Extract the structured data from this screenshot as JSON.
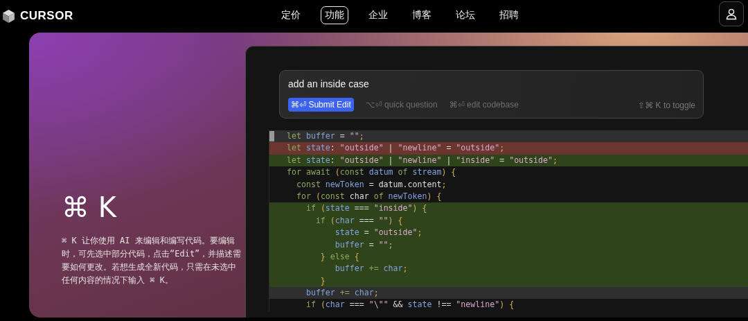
{
  "nav": {
    "logo": "CURSOR",
    "items": [
      {
        "label": "定价",
        "selected": false
      },
      {
        "label": "功能",
        "selected": true
      },
      {
        "label": "企业",
        "selected": false
      },
      {
        "label": "博客",
        "selected": false
      },
      {
        "label": "论坛",
        "selected": false
      },
      {
        "label": "招聘",
        "selected": false
      }
    ]
  },
  "hero": {
    "title": "⌘ K",
    "description": "⌘ K 让你使用 AI 来编辑和编写代码。要编辑时，可先选中部分代码，点击“Edit”，并描述需要如何更改。若想生成全新代码，只需在未选中任何内容的情况下输入 ⌘ K。"
  },
  "editor": {
    "prompt": {
      "value": "add an inside case",
      "actions": [
        {
          "label": "⌘⏎ Submit Edit",
          "kind": "primary"
        },
        {
          "label": "⌥⏎ quick question",
          "kind": "hint"
        },
        {
          "label": "⌘⏎ edit codebase",
          "kind": "hint"
        }
      ],
      "toggle_hint": "⇧⌘ K to toggle"
    },
    "lines": [
      {
        "kind": "current",
        "tokens": [
          {
            "kind": "kw",
            "text": "let "
          },
          {
            "kind": "var",
            "text": "buffer"
          },
          {
            "kind": "op",
            "text": " = "
          },
          {
            "kind": "str",
            "text": "\"\""
          },
          {
            "kind": "pun",
            "text": ";"
          }
        ]
      },
      {
        "kind": "removed",
        "tokens": [
          {
            "kind": "kw",
            "text": "let "
          },
          {
            "kind": "var",
            "text": "state"
          },
          {
            "kind": "op",
            "text": ": "
          },
          {
            "kind": "str",
            "text": "\"outside\""
          },
          {
            "kind": "op",
            "text": " | "
          },
          {
            "kind": "str",
            "text": "\"newline\""
          },
          {
            "kind": "op",
            "text": " = "
          },
          {
            "kind": "str",
            "text": "\"outside\""
          },
          {
            "kind": "pun",
            "text": ";"
          }
        ]
      },
      {
        "kind": "added",
        "tokens": [
          {
            "kind": "kw",
            "text": "let "
          },
          {
            "kind": "var",
            "text": "state"
          },
          {
            "kind": "op",
            "text": ": "
          },
          {
            "kind": "str",
            "text": "\"outside\""
          },
          {
            "kind": "op",
            "text": " | "
          },
          {
            "kind": "str",
            "text": "\"newline\""
          },
          {
            "kind": "op",
            "text": " | "
          },
          {
            "kind": "str",
            "text": "\"inside\""
          },
          {
            "kind": "op",
            "text": " = "
          },
          {
            "kind": "str",
            "text": "\"outside\""
          },
          {
            "kind": "pun",
            "text": ";"
          }
        ]
      },
      {
        "kind": "normal",
        "tokens": [
          {
            "kind": "kw",
            "text": "for await "
          },
          {
            "kind": "pun",
            "text": "("
          },
          {
            "kind": "kw",
            "text": "const "
          },
          {
            "kind": "var",
            "text": "datum"
          },
          {
            "kind": "kw",
            "text": " of "
          },
          {
            "kind": "var",
            "text": "stream"
          },
          {
            "kind": "pun",
            "text": ") {"
          }
        ]
      },
      {
        "kind": "normal",
        "tokens": [
          {
            "kind": "kw",
            "text": "  const "
          },
          {
            "kind": "var",
            "text": "newToken"
          },
          {
            "kind": "op",
            "text": " = datum.content"
          },
          {
            "kind": "pun",
            "text": ";"
          }
        ]
      },
      {
        "kind": "normal",
        "tokens": [
          {
            "kind": "kw",
            "text": "  for "
          },
          {
            "kind": "pun",
            "text": "("
          },
          {
            "kind": "kw",
            "text": "const "
          },
          {
            "kind": "op",
            "text": "char"
          },
          {
            "kind": "kw",
            "text": " of "
          },
          {
            "kind": "var",
            "text": "newToken"
          },
          {
            "kind": "pun",
            "text": ") {"
          }
        ]
      },
      {
        "kind": "added",
        "tokens": [
          {
            "kind": "kw",
            "text": "    if "
          },
          {
            "kind": "pun",
            "text": "("
          },
          {
            "kind": "var",
            "text": "state"
          },
          {
            "kind": "op",
            "text": " === "
          },
          {
            "kind": "str",
            "text": "\"inside\""
          },
          {
            "kind": "pun",
            "text": ") {"
          }
        ]
      },
      {
        "kind": "added",
        "tokens": [
          {
            "kind": "kw",
            "text": "      if "
          },
          {
            "kind": "pun",
            "text": "("
          },
          {
            "kind": "var",
            "text": "char"
          },
          {
            "kind": "op",
            "text": " === "
          },
          {
            "kind": "str",
            "text": "\"\""
          },
          {
            "kind": "pun",
            "text": ") {"
          }
        ]
      },
      {
        "kind": "added",
        "tokens": [
          {
            "kind": "var",
            "text": "          state"
          },
          {
            "kind": "op",
            "text": " = "
          },
          {
            "kind": "str",
            "text": "\"outside\""
          },
          {
            "kind": "pun",
            "text": ";"
          }
        ]
      },
      {
        "kind": "added",
        "tokens": [
          {
            "kind": "var",
            "text": "          buffer"
          },
          {
            "kind": "op",
            "text": " = "
          },
          {
            "kind": "str",
            "text": "\"\""
          },
          {
            "kind": "pun",
            "text": ";"
          }
        ]
      },
      {
        "kind": "added",
        "tokens": [
          {
            "kind": "pun",
            "text": "       } "
          },
          {
            "kind": "kw",
            "text": "else "
          },
          {
            "kind": "pun",
            "text": "{"
          }
        ]
      },
      {
        "kind": "added",
        "tokens": [
          {
            "kind": "var",
            "text": "          buffer"
          },
          {
            "kind": "kw",
            "text": " += "
          },
          {
            "kind": "var",
            "text": "char"
          },
          {
            "kind": "pun",
            "text": ";"
          }
        ]
      },
      {
        "kind": "added",
        "tokens": [
          {
            "kind": "pun",
            "text": "       }"
          }
        ]
      },
      {
        "kind": "current",
        "tokens": [
          {
            "kind": "var",
            "text": "    buffer"
          },
          {
            "kind": "kw",
            "text": " += "
          },
          {
            "kind": "var",
            "text": "char"
          },
          {
            "kind": "pun",
            "text": ";"
          }
        ]
      },
      {
        "kind": "normal",
        "tokens": [
          {
            "kind": "kw",
            "text": "    if "
          },
          {
            "kind": "pun",
            "text": "("
          },
          {
            "kind": "var",
            "text": "char"
          },
          {
            "kind": "op",
            "text": " === "
          },
          {
            "kind": "str",
            "text": "\"\\\"\""
          },
          {
            "kind": "op",
            "text": " && "
          },
          {
            "kind": "var",
            "text": "state"
          },
          {
            "kind": "op",
            "text": " !== "
          },
          {
            "kind": "str",
            "text": "\"newline\""
          },
          {
            "kind": "pun",
            "text": ") {"
          }
        ]
      }
    ]
  }
}
